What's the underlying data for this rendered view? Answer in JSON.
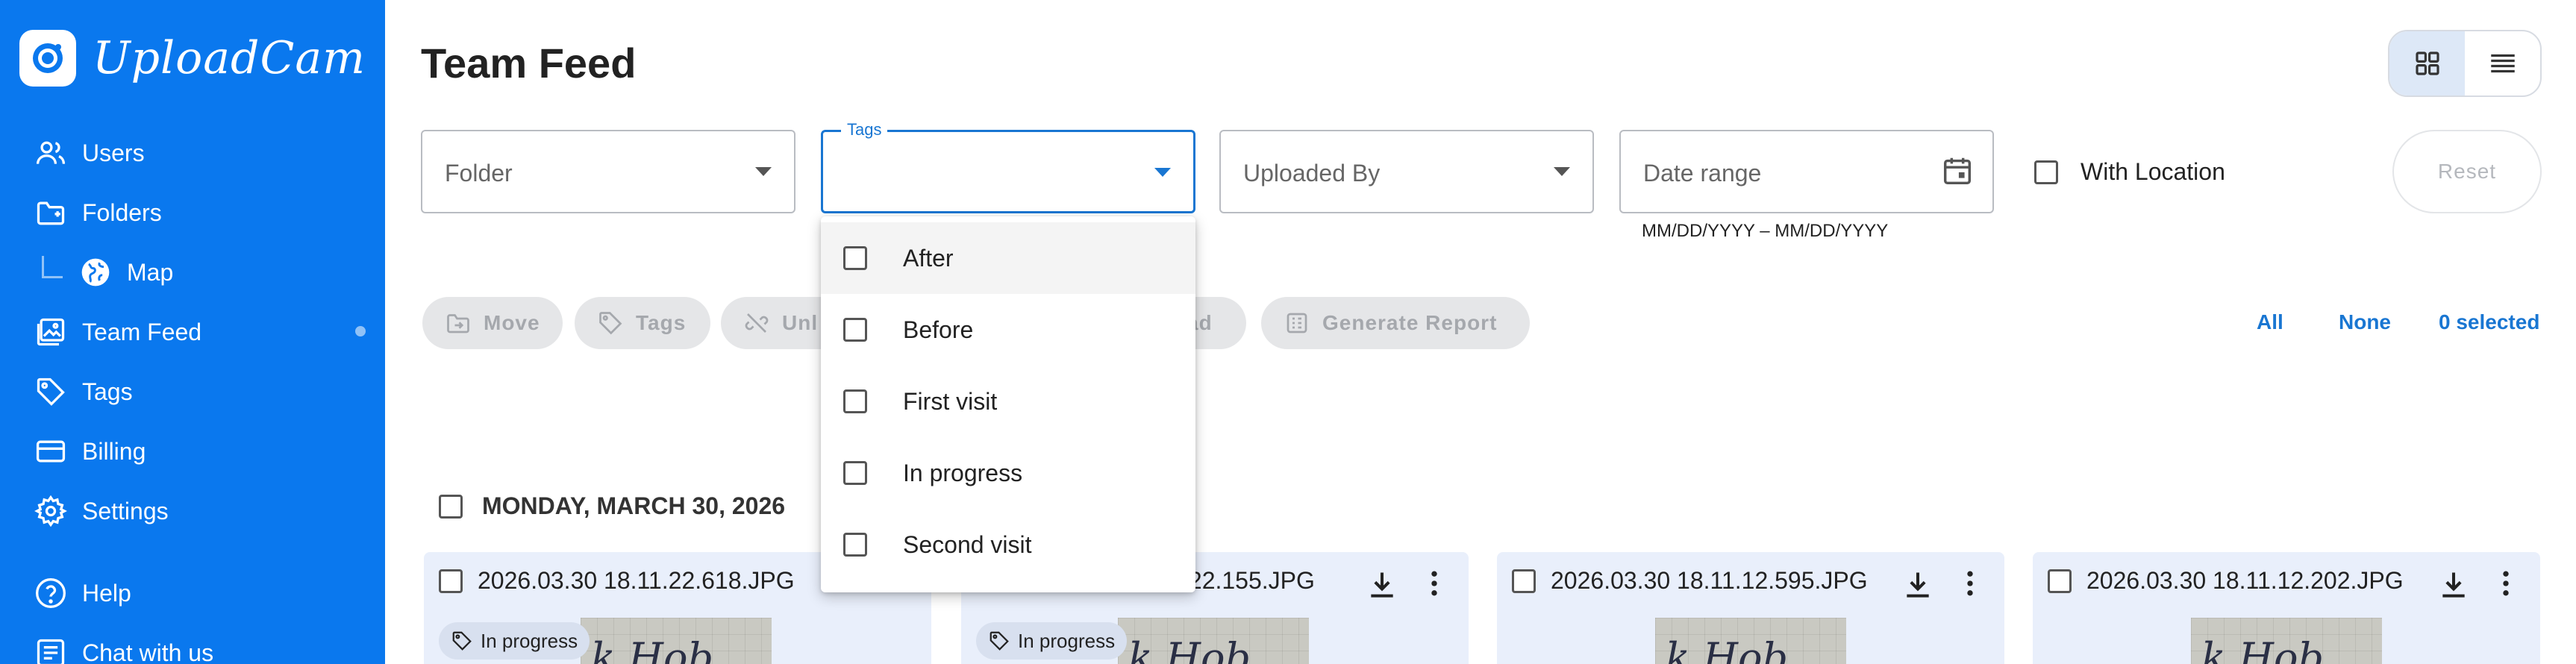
{
  "brand": {
    "name": "UploadCam"
  },
  "sidebar": {
    "items": [
      {
        "label": "Users",
        "icon": "users-icon"
      },
      {
        "label": "Folders",
        "icon": "folder-icon"
      },
      {
        "label": "Map",
        "icon": "globe-icon"
      },
      {
        "label": "Team Feed",
        "icon": "image-icon"
      },
      {
        "label": "Tags",
        "icon": "tag-icon"
      },
      {
        "label": "Billing",
        "icon": "credit-card-icon"
      },
      {
        "label": "Settings",
        "icon": "gear-icon"
      },
      {
        "label": "Help",
        "icon": "help-icon"
      },
      {
        "label": "Chat with us",
        "icon": "chat-icon"
      }
    ]
  },
  "page": {
    "title": "Team Feed"
  },
  "filters": {
    "folder": {
      "placeholder": "Folder"
    },
    "tags": {
      "label": "Tags",
      "value": ""
    },
    "uploaded_by": {
      "placeholder": "Uploaded By"
    },
    "date_range": {
      "placeholder": "Date range",
      "helper": "MM/DD/YYYY – MM/DD/YYYY"
    },
    "with_location": {
      "label": "With Location",
      "checked": false
    },
    "reset": "Reset"
  },
  "tags_menu": {
    "options": [
      {
        "label": "After",
        "checked": false
      },
      {
        "label": "Before",
        "checked": false
      },
      {
        "label": "First visit",
        "checked": false
      },
      {
        "label": "In progress",
        "checked": false
      },
      {
        "label": "Second visit",
        "checked": false
      }
    ]
  },
  "actions": {
    "move": "Move",
    "tags": "Tags",
    "unlink": "Unl",
    "download": "ad",
    "generate_report": "Generate Report"
  },
  "selection": {
    "all": "All",
    "none": "None",
    "count": "0 selected"
  },
  "feed": {
    "date_label": "MONDAY, MARCH 30, 2026",
    "cards": [
      {
        "filename": "2026.03.30 18.11.22.618.JPG",
        "tag": "In progress"
      },
      {
        "filename": ".22.155.JPG",
        "tag": "In progress"
      },
      {
        "filename": "2026.03.30 18.11.12.595.JPG"
      },
      {
        "filename": "2026.03.30 18.11.12.202.JPG"
      }
    ],
    "thumb_text": "k Hob"
  },
  "colors": {
    "sidebar": "#0a78ee",
    "accent": "#1976d2"
  }
}
